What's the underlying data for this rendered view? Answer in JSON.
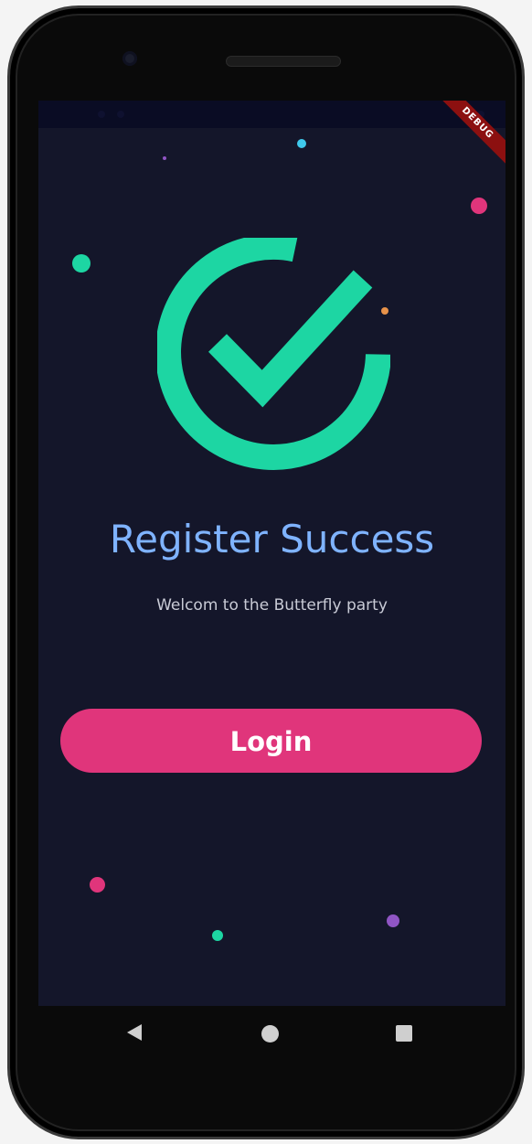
{
  "debug_banner": "DEBUG",
  "title": "Register Success",
  "subtitle": "Welcom to the Butterfly party",
  "login_button": "Login",
  "colors": {
    "background": "#14162a",
    "accent_green": "#1dd6a3",
    "title_blue": "#7fb3ff",
    "button_pink": "#e0357b",
    "dot_cyan": "#3fc9ec",
    "dot_purple": "#9055c4",
    "dot_orange": "#e8924a"
  },
  "icons": {
    "check": "check-circle-icon",
    "nav_back": "back-triangle-icon",
    "nav_home": "home-circle-icon",
    "nav_recent": "recent-square-icon"
  }
}
